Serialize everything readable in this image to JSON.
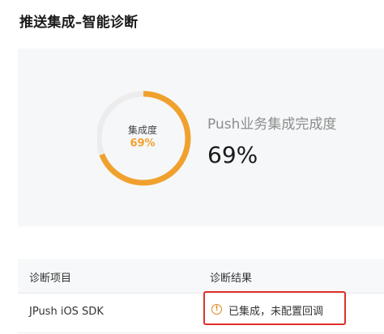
{
  "page": {
    "title": "推送集成–智能诊断"
  },
  "integration": {
    "ring_label": "集成度",
    "ring_value_text": "69%",
    "progress_fraction": 0.69,
    "metric_title": "Push业务集成完成度",
    "metric_value": "69%",
    "accent_color": "#f0a12d",
    "track_color": "#ececec"
  },
  "diagnosis_table": {
    "headers": [
      "诊断项目",
      "诊断结果"
    ],
    "rows": [
      {
        "item": "JPush iOS SDK",
        "result": "已集成，未配置回调",
        "status_icon": "warning-circle-icon"
      }
    ]
  }
}
